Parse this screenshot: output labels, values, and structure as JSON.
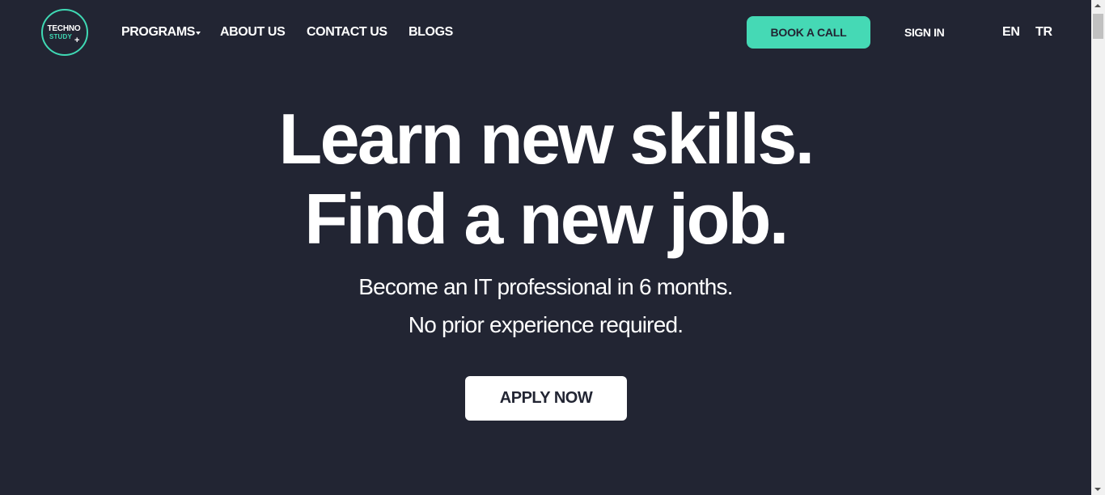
{
  "brand": {
    "logo_line1": "TECHNO",
    "logo_line2": "STUDY",
    "logo_plus": "+"
  },
  "nav": {
    "programs": "PROGRAMS",
    "about": "ABOUT US",
    "contact": "CONTACT US",
    "blogs": "BLOGS"
  },
  "header": {
    "book_call": "BOOK A CALL",
    "sign_in": "SIGN IN",
    "lang_en": "EN",
    "lang_tr": "TR"
  },
  "hero": {
    "title_line1": "Learn new skills.",
    "title_line2": "Find a new job.",
    "subtitle_line1": "Become an IT professional in 6 months.",
    "subtitle_line2": "No prior experience required.",
    "apply": "APPLY NOW"
  },
  "colors": {
    "background": "#222533",
    "accent": "#45d9b5",
    "text": "#ffffff"
  }
}
